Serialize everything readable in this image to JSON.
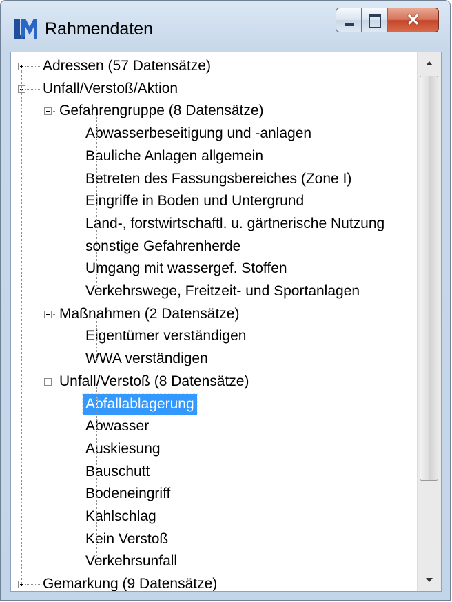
{
  "window": {
    "title": "Rahmendaten"
  },
  "tree": {
    "nodes": [
      {
        "label": "Adressen (57 Datensätze)",
        "level": 0,
        "expander": "plus"
      },
      {
        "label": "Unfall/Verstoß/Aktion",
        "level": 0,
        "expander": "minus"
      },
      {
        "label": "Gefahrengruppe (8 Datensätze)",
        "level": 1,
        "expander": "minus"
      },
      {
        "label": "Abwasserbeseitigung und -anlagen",
        "level": 2
      },
      {
        "label": "Bauliche Anlagen allgemein",
        "level": 2
      },
      {
        "label": "Betreten des Fassungsbereiches (Zone I)",
        "level": 2
      },
      {
        "label": "Eingriffe in Boden und Untergrund",
        "level": 2
      },
      {
        "label": "Land-, forstwirtschaftl. u. gärtnerische Nutzung",
        "level": 2
      },
      {
        "label": "sonstige Gefahrenherde",
        "level": 2
      },
      {
        "label": "Umgang mit wassergef. Stoffen",
        "level": 2
      },
      {
        "label": "Verkehrswege, Freitzeit- und Sportanlagen",
        "level": 2
      },
      {
        "label": "Maßnahmen (2 Datensätze)",
        "level": 1,
        "expander": "minus"
      },
      {
        "label": "Eigentümer verständigen",
        "level": 2
      },
      {
        "label": "WWA verständigen",
        "level": 2
      },
      {
        "label": "Unfall/Verstoß (8 Datensätze)",
        "level": 1,
        "expander": "minus"
      },
      {
        "label": "Abfallablagerung",
        "level": 2,
        "selected": true
      },
      {
        "label": "Abwasser",
        "level": 2
      },
      {
        "label": "Auskiesung",
        "level": 2
      },
      {
        "label": "Bauschutt",
        "level": 2
      },
      {
        "label": "Bodeneingriff",
        "level": 2
      },
      {
        "label": "Kahlschlag",
        "level": 2
      },
      {
        "label": "Kein Verstoß",
        "level": 2
      },
      {
        "label": "Verkehrsunfall",
        "level": 2
      },
      {
        "label": "Gemarkung (9 Datensätze)",
        "level": 0,
        "expander": "plus"
      }
    ]
  },
  "colors": {
    "selection": "#3399ff",
    "close_button": "#c4472a",
    "app_icon": "#1f4e9c"
  },
  "icons": {
    "app": "lm-logo-icon",
    "minimize": "minimize-icon",
    "maximize": "maximize-icon",
    "close": "close-icon"
  }
}
